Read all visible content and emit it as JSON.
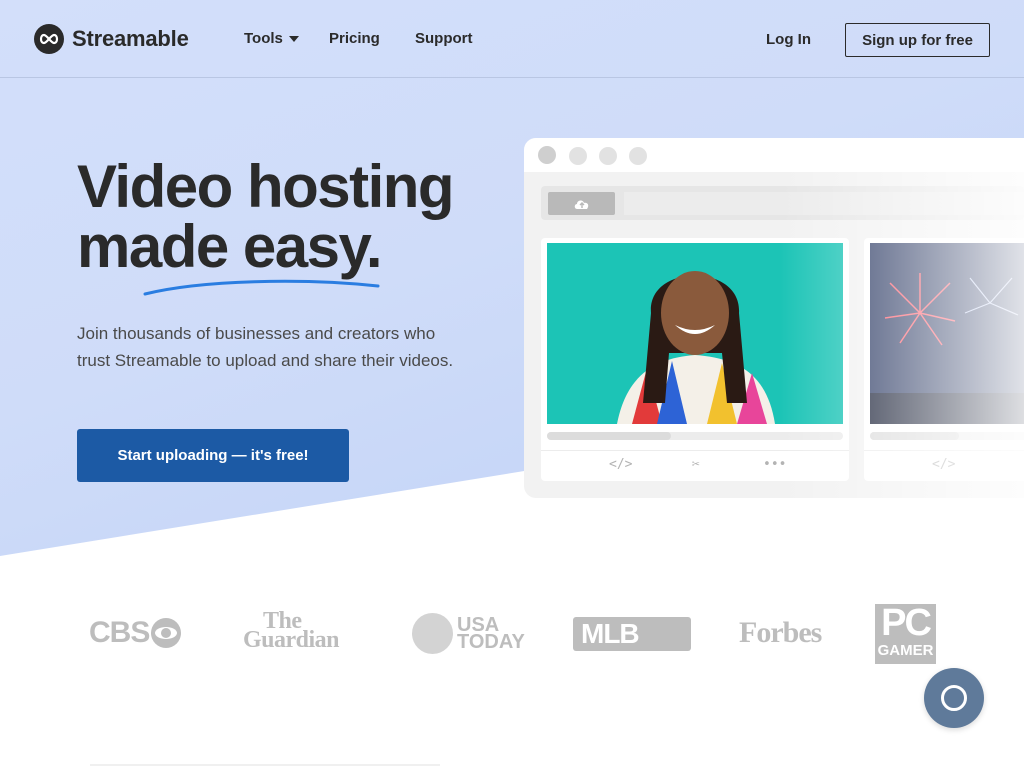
{
  "header": {
    "logo_text": "Streamable",
    "nav": {
      "tools": "Tools",
      "pricing": "Pricing",
      "support": "Support"
    },
    "login": "Log In",
    "signup": "Sign up for free"
  },
  "hero": {
    "headline_line1": "Video hosting",
    "headline_line2": "made easy.",
    "subtext": "Join thousands of businesses and creators who trust Streamable to upload and share their videos.",
    "cta": "Start uploading — it's free!"
  },
  "mockup": {
    "card1_icons": [
      "</>",
      "✂",
      "•••"
    ],
    "card2_icons": [
      "</>"
    ],
    "card1_progress": 0.42,
    "card2_progress": 0.3
  },
  "press_logos": {
    "cbs": "CBS",
    "guardian_line1": "The",
    "guardian_line2": "Guardian",
    "usa_line1": "USA",
    "usa_line2": "TODAY",
    "mlb": "MLB",
    "forbes": "Forbes",
    "pc": "PC",
    "gamer": "GAMER"
  },
  "colors": {
    "brand_blue": "#1c5aa5",
    "hero_bg": "#cfdcf9",
    "help_bubble": "#5f7a9a"
  }
}
